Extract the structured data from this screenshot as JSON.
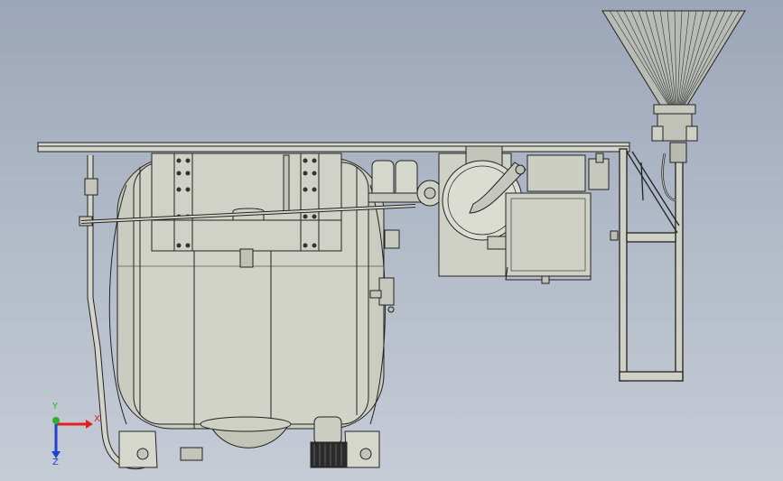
{
  "viewport": {
    "background_top": "#9ba6b8",
    "background_bottom": "#c6ccd6",
    "body_color": "#cfd0c4",
    "edge_color": "#222222"
  },
  "triad": {
    "x_label": "X",
    "y_label": "Y",
    "z_label": "Z",
    "x_color": "#e02020",
    "y_color": "#2bb02b",
    "z_color": "#2040d0"
  }
}
